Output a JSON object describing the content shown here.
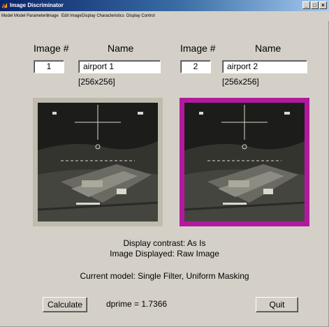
{
  "window": {
    "title": "Image Discriminator",
    "controls": [
      "_",
      "□",
      "×"
    ]
  },
  "menu": [
    "Model",
    "Model Parameters",
    "Image",
    "Edit Image",
    "Display Characteristics",
    "Display Control"
  ],
  "left_image": {
    "number_header": "Image #",
    "name_header": "Name",
    "number": "1",
    "name": "airport 1",
    "size": "[256x256]",
    "selected": false
  },
  "right_image": {
    "number_header": "Image #",
    "name_header": "Name",
    "number": "2",
    "name": "airport 2",
    "size": "[256x256]",
    "selected": true,
    "highlight_color": "#b3199f"
  },
  "status": {
    "display_contrast": "Display contrast: As Is",
    "image_displayed": "Image Displayed: Raw Image",
    "current_model": "Current model: Single Filter, Uniform Masking"
  },
  "actions": {
    "calculate_label": "Calculate",
    "dprime_text": "dprime = 1.7366",
    "quit_label": "Quit"
  },
  "colors": {
    "background": "#d4d0c8",
    "unselected_frame": "#bfbcae",
    "selected_frame": "#b3199f"
  }
}
